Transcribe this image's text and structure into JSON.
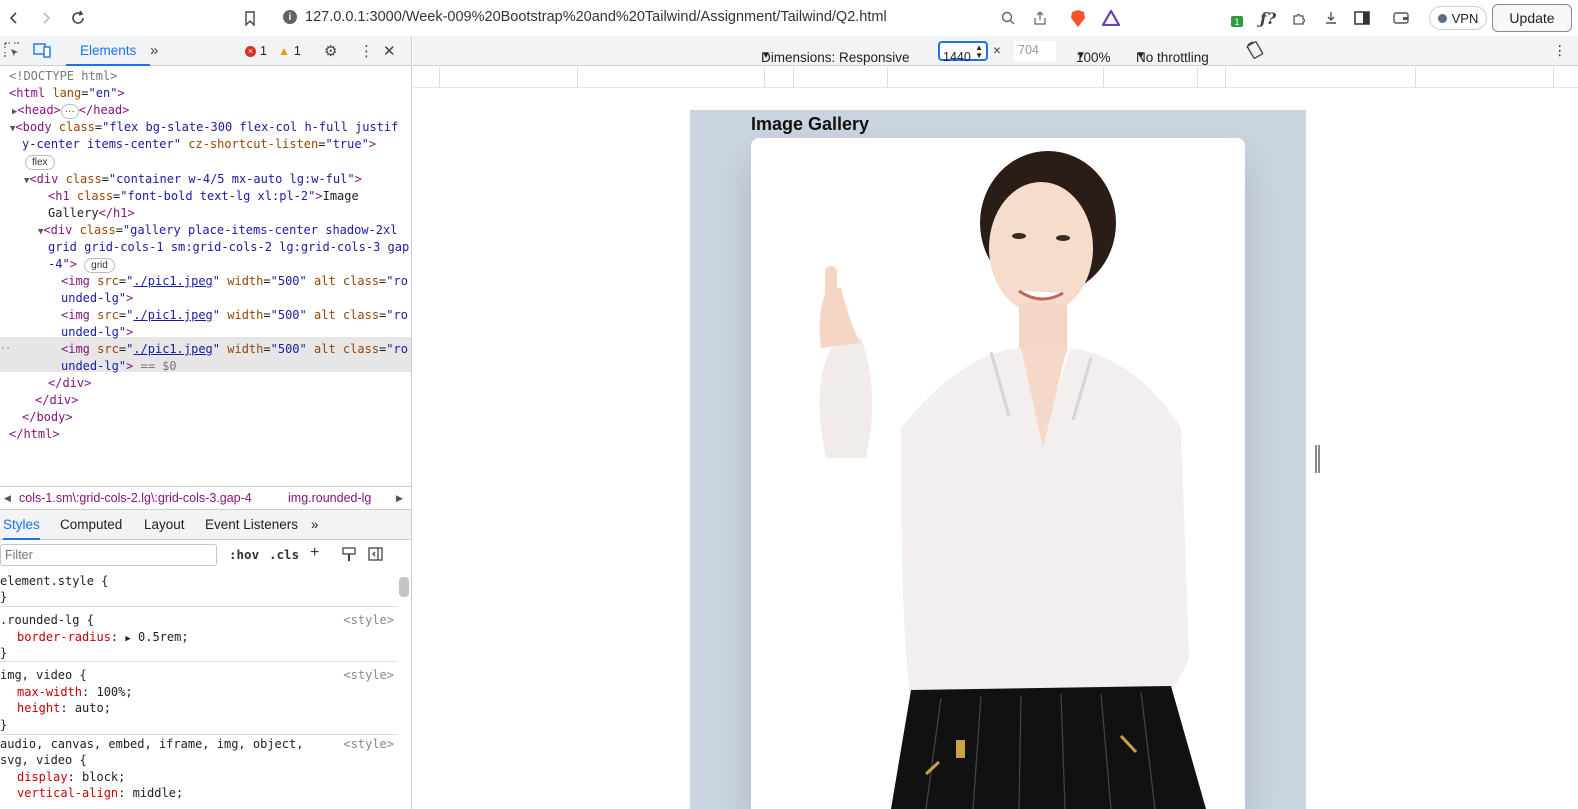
{
  "browser": {
    "url": "127.0.0.1:3000/Week-009%20Bootstrap%20and%20Tailwind/Assignment/Tailwind/Q2.html",
    "vpn_label": "VPN",
    "update_label": "Update",
    "ext_badge": "1"
  },
  "devtools": {
    "tab_elements": "Elements",
    "errors": "1",
    "warnings": "1",
    "dom": [
      "<!DOCTYPE html>",
      "html",
      "head",
      "body",
      "div container",
      "h1",
      "gallery"
    ],
    "doctype": "<!DOCTYPE html>",
    "html_lang": "en",
    "body_class": "flex bg-slate-300 flex-col h-full justif",
    "body_class_cont": "y-center items-center",
    "body_attr2": "cz-shortcut-listen",
    "body_attr2_val": "true",
    "flex_pill": "flex",
    "div_class": "container w-4/5 mx-auto lg:w-ful",
    "h1_class": "font-bold text-lg xl:pl-2",
    "h1_text_1": "Image",
    "h1_text_2": "Gallery",
    "gallery_class_1": "gallery place-items-center shadow-2xl",
    "gallery_class_2": "grid grid-cols-1 sm:grid-cols-2 lg:grid-cols-3 gap",
    "gallery_class_3": "-4",
    "grid_pill": "grid",
    "img_src": "./pic1.jpeg",
    "img_width": "500",
    "img_class_1": "ro",
    "img_class_2": "unded-lg",
    "selected_suffix": "== $0",
    "crumb_1": "cols-1.sm\\:grid-cols-2.lg\\:grid-cols-3.gap-4",
    "crumb_2": "img.rounded-lg",
    "style_tabs": [
      "Styles",
      "Computed",
      "Layout",
      "Event Listeners"
    ],
    "filter_placeholder": "Filter",
    "hov": ":hov",
    "cls": ".cls",
    "rules": {
      "r1_sel": "element.style {",
      "r2_sel": ".rounded-lg {",
      "r2_prop": "border-radius",
      "r2_val": "0.5rem;",
      "r3_sel": "img, video {",
      "r3_p1": "max-width",
      "r3_v1": "100%;",
      "r3_p2": "height",
      "r3_v2": "auto;",
      "r4_sel_1": "audio, canvas, embed, iframe, img, object,",
      "r4_sel_2": "svg, video {",
      "r4_p1": "display",
      "r4_v1": "block;",
      "r4_p2": "vertical-align",
      "r4_v2": "middle;",
      "source": "<style>",
      "close": "}"
    }
  },
  "responsive": {
    "dimensions_label": "Dimensions: Responsive",
    "width": "1440",
    "height": "704",
    "zoom": "100%",
    "throttling": "No throttling"
  },
  "page": {
    "title": "Image Gallery"
  }
}
